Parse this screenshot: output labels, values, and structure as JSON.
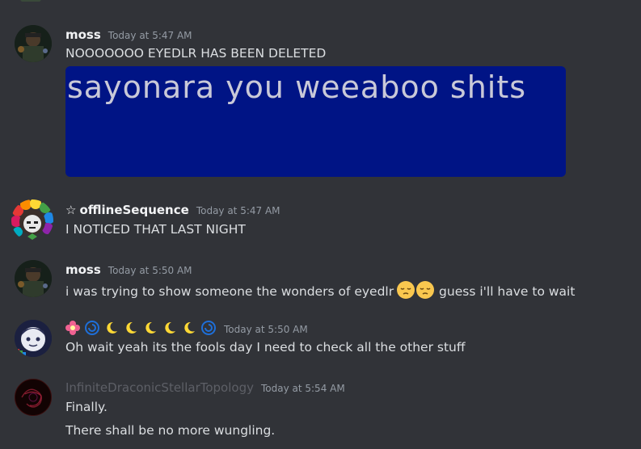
{
  "top_fragment": "",
  "messages": [
    {
      "username": "moss",
      "timestamp": "Today at 5:47 AM",
      "lines": [
        "NOOOOOOO EYEDLR HAS BEEN DELETED"
      ],
      "embed_text": "sayonara you weeaboo shits",
      "embed_color": "#001485"
    },
    {
      "username": "offlineSequence",
      "prefix_icon": "star-outline-icon",
      "timestamp": "Today at 5:47 AM",
      "lines": [
        "I NOTICED THAT LAST NIGHT"
      ]
    },
    {
      "username": "moss",
      "timestamp": "Today at 5:50 AM",
      "line_before": "i was trying to show someone the wonders of eyedlr",
      "emojis": [
        "pensive-face-icon",
        "pensive-face-icon"
      ],
      "line_after": "guess i'll have to wait"
    },
    {
      "username_emoji": [
        "flower-icon",
        "spiral-icon",
        "crescent-moon-icon",
        "crescent-moon-icon",
        "crescent-moon-icon",
        "crescent-moon-icon",
        "crescent-moon-icon",
        "spiral-icon"
      ],
      "timestamp": "Today at 5:50 AM",
      "lines": [
        "Oh wait yeah its the fools day I need to check all the other stuff"
      ]
    },
    {
      "username": "InfiniteDraconicStellarTopology",
      "timestamp": "Today at 5:54 AM",
      "lines": [
        "Finally.",
        "There shall be no more wungling."
      ]
    }
  ]
}
